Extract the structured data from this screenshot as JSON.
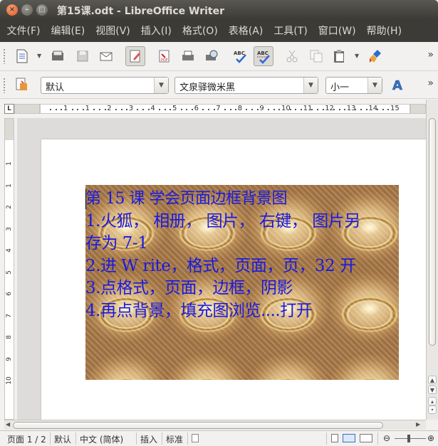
{
  "window": {
    "title": "第15课.odt - LibreOffice Writer"
  },
  "menu": [
    "文件(F)",
    "编辑(E)",
    "视图(V)",
    "插入(I)",
    "格式(O)",
    "表格(A)",
    "工具(T)",
    "窗口(W)",
    "帮助(H)"
  ],
  "toolbar": {
    "icons": [
      "new-document-icon",
      "open-icon",
      "save-icon",
      "email-icon",
      "edit-mode-icon",
      "export-pdf-icon",
      "print-icon",
      "print-preview-icon",
      "spellcheck-icon",
      "autospellcheck-icon",
      "cut-icon",
      "copy-icon",
      "paste-icon",
      "format-paintbrush-icon"
    ],
    "spell_label": "ABC"
  },
  "formatting": {
    "style": "默认",
    "font": "文泉驿微米黑",
    "size": "小一"
  },
  "ruler": {
    "h_numbers": [
      "1",
      "1",
      "2",
      "3",
      "4",
      "5",
      "6",
      "7",
      "8",
      "9",
      "10",
      "11",
      "12",
      "13",
      "14",
      "15"
    ],
    "v_numbers": [
      "1",
      "1",
      "2",
      "3",
      "4",
      "5",
      "6",
      "7",
      "8",
      "9",
      "10"
    ]
  },
  "document": {
    "lines": [
      "第 15 课 学会页面边框背景图",
      "1.火狐， 相册， 图片， 右键， 图片另",
      "存为 7-1",
      "2.进 W rite，格式，页面，页，32 开",
      "3.点格式，页面，边框，阴影",
      "4.再点背景，填充图浏览....打开"
    ],
    "text_color": "#1a1ae0"
  },
  "status": {
    "page": "页面 1 / 2",
    "style": "默认",
    "language": "中文 (简体)",
    "insert_mode": "插入",
    "selection_mode": "标准"
  }
}
